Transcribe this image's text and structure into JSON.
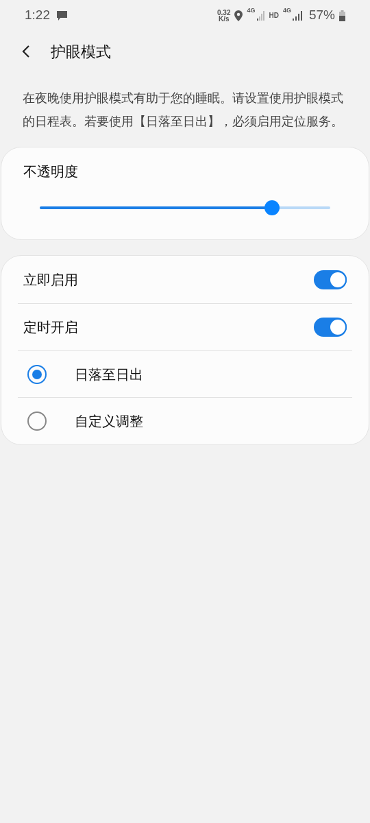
{
  "status_bar": {
    "time": "1:22",
    "net_speed": "0.32",
    "net_unit": "K/s",
    "sim1": "4G",
    "hd": "HD",
    "sim2": "4G",
    "battery": "57%"
  },
  "header": {
    "title": "护眼模式"
  },
  "description": "在夜晚使用护眼模式有助于您的睡眠。请设置使用护眼模式的日程表。若要使用【日落至日出】，必须启用定位服务。",
  "opacity": {
    "label": "不透明度",
    "level": 0.8
  },
  "settings": [
    {
      "kind": "toggle",
      "label": "立即启用",
      "on": true
    },
    {
      "kind": "toggle",
      "label": "定时开启",
      "on": true
    },
    {
      "kind": "radio",
      "label": "日落至日出",
      "selected": true
    },
    {
      "kind": "radio",
      "label": "自定义调整",
      "selected": false
    }
  ]
}
